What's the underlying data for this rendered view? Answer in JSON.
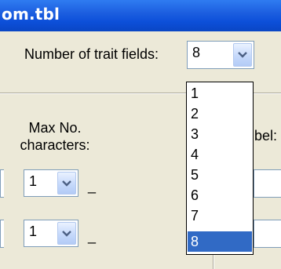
{
  "window": {
    "title": "om.tbl"
  },
  "trait_fields": {
    "label": "Number of trait fields:",
    "value": "8",
    "options": [
      "1",
      "2",
      "3",
      "4",
      "5",
      "6",
      "7",
      "8"
    ],
    "selected": "8"
  },
  "columns": {
    "max_no_line1": "Max No.",
    "max_no_line2": "characters:",
    "label_header": "bel:"
  },
  "rows": [
    {
      "max_chars": "1",
      "dash": "_"
    },
    {
      "max_chars": "1",
      "dash": "_"
    }
  ],
  "colors": {
    "titlebar": "#0c4fd9",
    "dialog_bg": "#ece9d8",
    "selection": "#316ac5",
    "field_border": "#7f9db9"
  }
}
